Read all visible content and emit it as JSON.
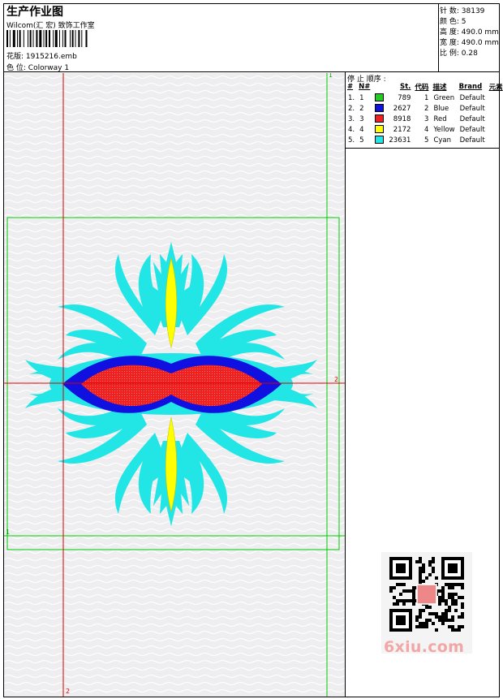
{
  "header": {
    "title": "生产作业图",
    "company": "Wilcom(汇 宏) 致饰工作室",
    "design_label": "花版:",
    "design_value": "1915216.emb",
    "colorway_label": "色 位:",
    "colorway_value": "Colorway 1"
  },
  "stats": [
    {
      "label": "针 数:",
      "value": "38139"
    },
    {
      "label": "颜 色:",
      "value": "5"
    },
    {
      "label": "高 度:",
      "value": "490.0 mm"
    },
    {
      "label": "宽 度:",
      "value": "490.0 mm"
    },
    {
      "label": "比 例:",
      "value": "0.28"
    }
  ],
  "stop_sequence": {
    "title": "停 止 顺序 :",
    "columns": [
      "#",
      "N#",
      "St.",
      "代码",
      "描述",
      "Brand",
      "元素"
    ],
    "rows": [
      {
        "index": "1.",
        "n": "1",
        "stitches": "789",
        "code": "1",
        "desc": "Green",
        "brand": "Default",
        "color": "#22cc22"
      },
      {
        "index": "2.",
        "n": "2",
        "stitches": "2627",
        "code": "2",
        "desc": "Blue",
        "brand": "Default",
        "color": "#1010e0"
      },
      {
        "index": "3.",
        "n": "3",
        "stitches": "8918",
        "code": "3",
        "desc": "Red",
        "brand": "Default",
        "color": "#ee2020"
      },
      {
        "index": "4.",
        "n": "4",
        "stitches": "2172",
        "code": "4",
        "desc": "Yellow",
        "brand": "Default",
        "color": "#ffff00"
      },
      {
        "index": "5.",
        "n": "5",
        "stitches": "23631",
        "code": "5",
        "desc": "Cyan",
        "brand": "Default",
        "color": "#22e6e6"
      }
    ]
  },
  "guides": {
    "marker_1": "1",
    "marker_2": "2"
  },
  "watermark": "6xiu.com",
  "colors": {
    "green": "#22cc22",
    "blue": "#1010e0",
    "red": "#ee2020",
    "yellow": "#ffff00",
    "cyan": "#22e6e6",
    "guide_red": "#dd0000",
    "guide_green": "#00cc00",
    "canvas_bg": "#eeeef0"
  }
}
